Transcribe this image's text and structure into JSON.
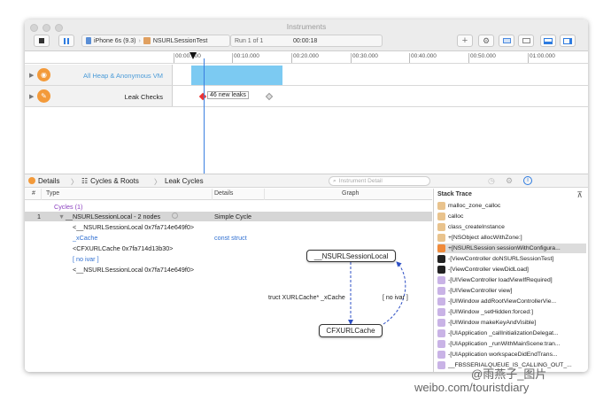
{
  "window": {
    "title": "Instruments"
  },
  "toolbar": {
    "stop_icon": "stop-icon",
    "pause_icon": "pause-icon",
    "device_target": "iPhone 6s (9.3)",
    "app_target": "NSURLSessionTest",
    "run_label": "Run 1 of 1",
    "elapsed": "00:00:18"
  },
  "ruler": {
    "ticks": [
      "00:00.000",
      "00:10.000",
      "00:20.000",
      "00:30.000",
      "00:40.000",
      "00:50.000",
      "01:00.000"
    ]
  },
  "tracks": [
    {
      "name": "All Heap & Anonymous VM",
      "color": "#f39a3a"
    },
    {
      "name": "Leak Checks",
      "color": "#f39a3a"
    }
  ],
  "leak_flag": "46 new leaks",
  "breadcrumb": {
    "details": "Details",
    "cycles_roots": "Cycles & Roots",
    "leak_cycles": "Leak Cycles"
  },
  "detail_search": {
    "placeholder": "Instrument Detail"
  },
  "columns": {
    "num": "#",
    "type": "Type",
    "details": "Details",
    "graph": "Graph"
  },
  "cycles": {
    "group": "Cycles (1)",
    "row_num": "1",
    "row_type": "__NSURLSessionLocal - 2 nodes",
    "row_detail": "Simple Cycle",
    "children": [
      "<__NSURLSessionLocal 0x7fa714e649f0>",
      "_xCache",
      "<CFXURLCache 0x7fa714d13b30>",
      "[ no ivar ]",
      "<__NSURLSessionLocal 0x7fa714e649f0>"
    ],
    "child_detail": "const struct"
  },
  "graph": {
    "node_top": "__NSURLSessionLocal",
    "node_bottom": "CFXURLCache",
    "edge_left": "truct XURLCache* _xCache",
    "edge_right": "[ no ivar ]"
  },
  "stack_trace": {
    "title": "Stack Trace",
    "frames": [
      {
        "label": "malloc_zone_calloc",
        "color": "#e9c38d"
      },
      {
        "label": "calloc",
        "color": "#e9c38d"
      },
      {
        "label": "class_createInstance",
        "color": "#e9c38d"
      },
      {
        "label": "+[NSObject allocWithZone:]",
        "color": "#e9c38d"
      },
      {
        "label": "+[NSURLSession sessionWithConfigura...",
        "color": "#f08a3a"
      },
      {
        "label": "-[ViewController doNSURLSessionTest]",
        "color": "#222222"
      },
      {
        "label": "-[ViewController viewDidLoad]",
        "color": "#222222"
      },
      {
        "label": "-[UIViewController loadViewIfRequired]",
        "color": "#c9b3e6"
      },
      {
        "label": "-[UIViewController view]",
        "color": "#c9b3e6"
      },
      {
        "label": "-[UIWindow addRootViewControllerVie...",
        "color": "#c9b3e6"
      },
      {
        "label": "-[UIWindow _setHidden:forced:]",
        "color": "#c9b3e6"
      },
      {
        "label": "-[UIWindow makeKeyAndVisible]",
        "color": "#c9b3e6"
      },
      {
        "label": "-[UIApplication _callInitializationDelegat...",
        "color": "#c9b3e6"
      },
      {
        "label": "-[UIApplication _runWithMainScene:tran...",
        "color": "#c9b3e6"
      },
      {
        "label": "-[UIApplication workspaceDidEndTrans...",
        "color": "#c9b3e6"
      },
      {
        "label": "__FBSSERIALQUEUE_IS_CALLING_OUT_...",
        "color": "#c9b3e6"
      }
    ]
  },
  "watermark": {
    "line1": "@雨燕子_图片",
    "line2": "weibo.com/touristdiary"
  }
}
